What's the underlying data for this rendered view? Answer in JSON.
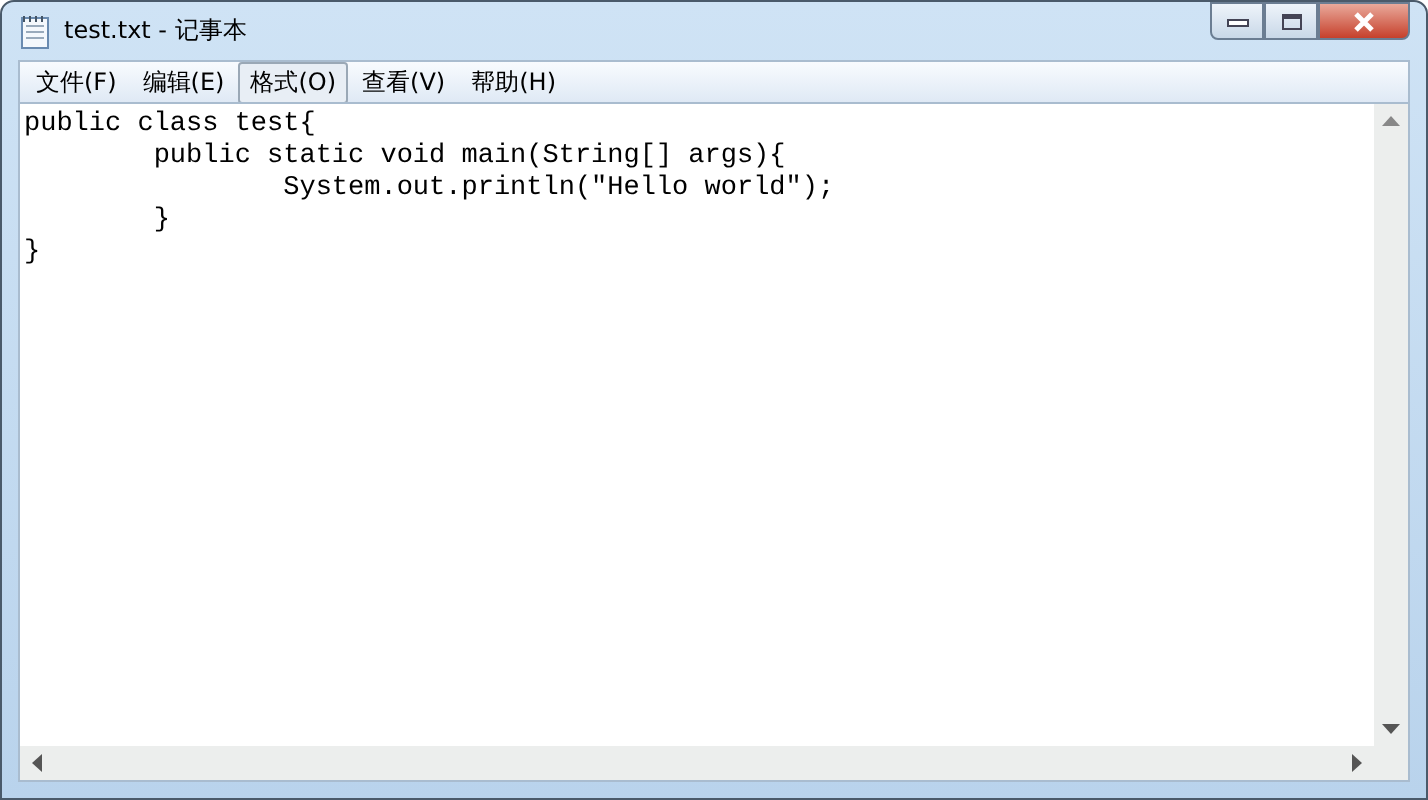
{
  "window": {
    "title": "test.txt - 记事本"
  },
  "menu": [
    {
      "label": "文件(F)",
      "selected": false
    },
    {
      "label": "编辑(E)",
      "selected": false
    },
    {
      "label": "格式(O)",
      "selected": true
    },
    {
      "label": "查看(V)",
      "selected": false
    },
    {
      "label": "帮助(H)",
      "selected": false
    }
  ],
  "editor": {
    "value": "public class test{\n\tpublic static void main(String[] args){\n\t\tSystem.out.println(\"Hello world\");\n\t}\n}"
  }
}
